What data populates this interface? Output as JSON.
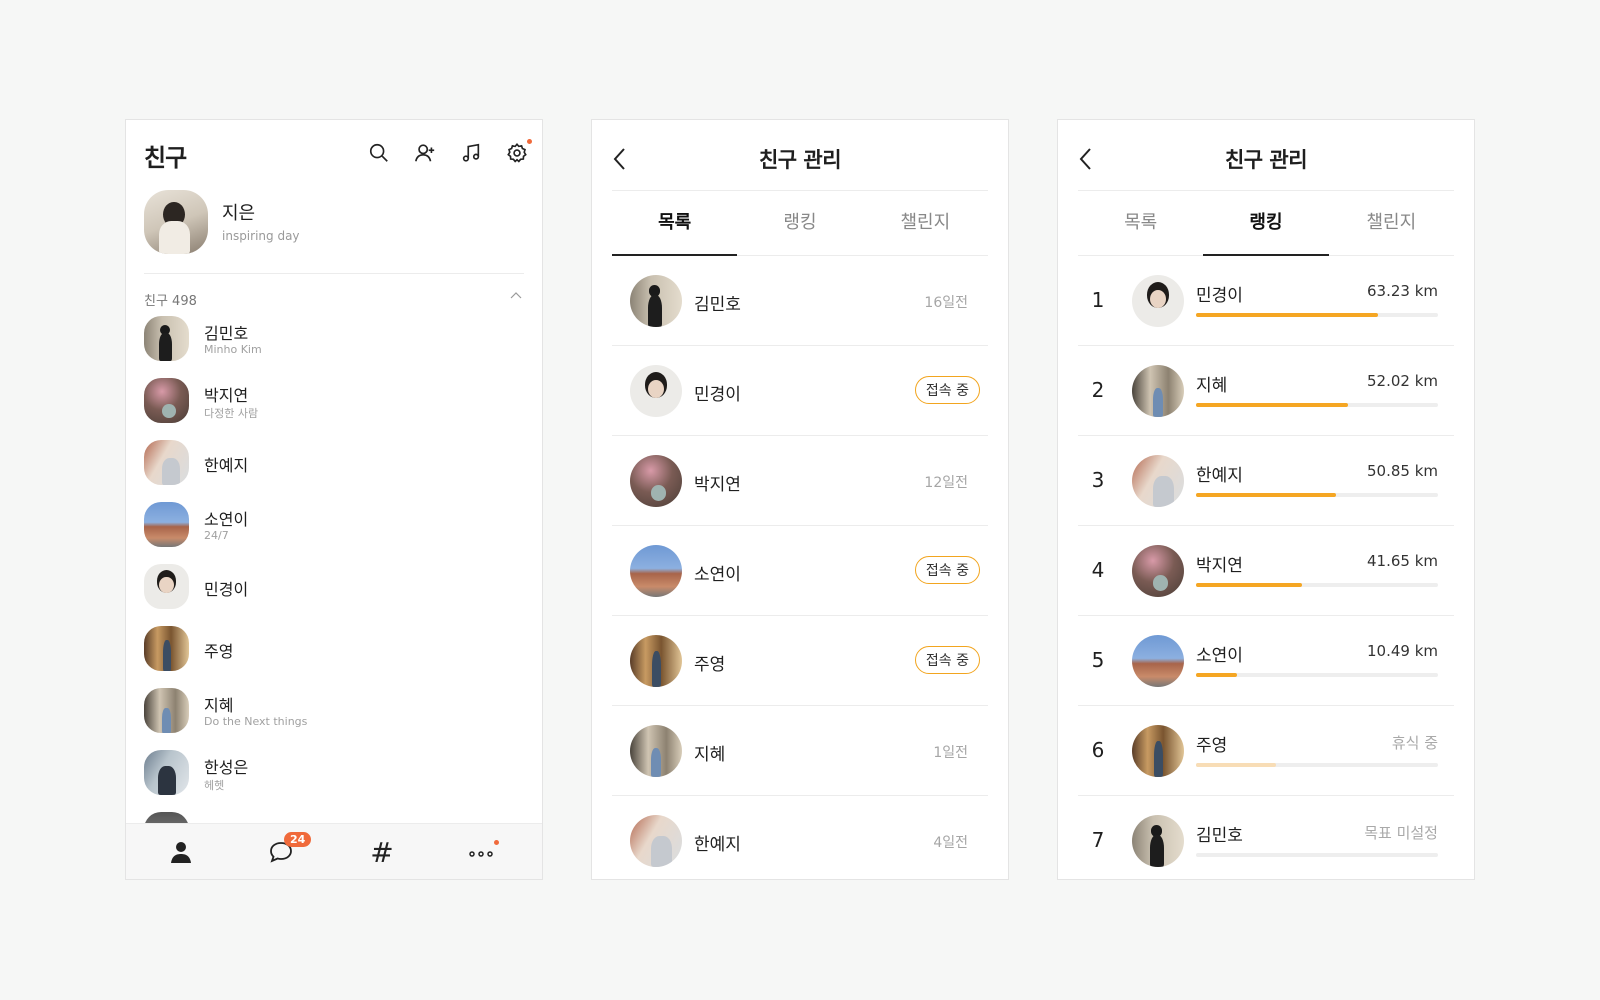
{
  "colors": {
    "accent": "#f5a623",
    "badge": "#f06a3b"
  },
  "friends_panel": {
    "title": "친구",
    "icons": [
      "search-icon",
      "add-friend-icon",
      "music-icon",
      "settings-icon"
    ],
    "me": {
      "name": "지은",
      "status": "inspiring day"
    },
    "friends_label": "친구 498",
    "friends": [
      {
        "name": "김민호",
        "sub": "Minho Kim"
      },
      {
        "name": "박지연",
        "sub": "다정한 사람"
      },
      {
        "name": "한예지",
        "sub": ""
      },
      {
        "name": "소연이",
        "sub": "24/7"
      },
      {
        "name": "민경이",
        "sub": ""
      },
      {
        "name": "주영",
        "sub": ""
      },
      {
        "name": "지혜",
        "sub": "Do the Next things"
      },
      {
        "name": "한성은",
        "sub": "헤헷"
      }
    ],
    "tabbar": {
      "chat_badge": "24",
      "hash": "#"
    }
  },
  "manage_list": {
    "title": "친구 관리",
    "tabs": [
      "목록",
      "랭킹",
      "챌린지"
    ],
    "active_tab": "목록",
    "rows": [
      {
        "name": "김민호",
        "status": "16일전",
        "online": false
      },
      {
        "name": "민경이",
        "status": "접속 중",
        "online": true
      },
      {
        "name": "박지연",
        "status": "12일전",
        "online": false
      },
      {
        "name": "소연이",
        "status": "접속 중",
        "online": true
      },
      {
        "name": "주영",
        "status": "접속 중",
        "online": true
      },
      {
        "name": "지혜",
        "status": "1일전",
        "online": false
      },
      {
        "name": "한예지",
        "status": "4일전",
        "online": false
      }
    ]
  },
  "manage_ranking": {
    "title": "친구 관리",
    "tabs": [
      "목록",
      "랭킹",
      "챌린지"
    ],
    "active_tab": "랭킹",
    "rows": [
      {
        "rank": "1",
        "name": "민경이",
        "value": "63.23 km",
        "progress": 0.75
      },
      {
        "rank": "2",
        "name": "지혜",
        "value": "52.02 km",
        "progress": 0.63
      },
      {
        "rank": "3",
        "name": "한예지",
        "value": "50.85 km",
        "progress": 0.58
      },
      {
        "rank": "4",
        "name": "박지연",
        "value": "41.65 km",
        "progress": 0.44
      },
      {
        "rank": "5",
        "name": "소연이",
        "value": "10.49 km",
        "progress": 0.17
      },
      {
        "rank": "6",
        "name": "주영",
        "value": "휴식 중",
        "progress": 0.33
      },
      {
        "rank": "7",
        "name": "김민호",
        "value": "목표 미설정",
        "progress": 0
      }
    ]
  }
}
